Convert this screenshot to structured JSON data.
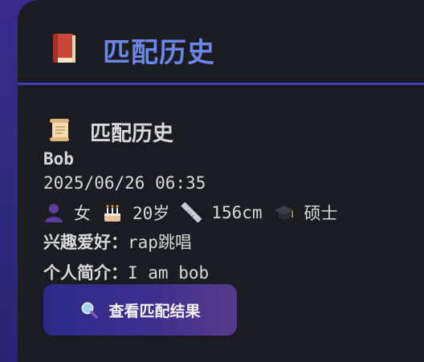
{
  "header": {
    "title": "匹配历史",
    "icon": "book-icon"
  },
  "section": {
    "title": "匹配历史",
    "icon": "scroll-icon"
  },
  "record": {
    "name": "Bob",
    "time": "2025/06/26 06:35",
    "gender": "女",
    "age": "20岁",
    "height": "156cm",
    "education": "硕士",
    "hobby_label": "兴趣爱好：",
    "hobby": "rap跳唱",
    "intro_label": "个人简介：",
    "intro": "I am bob"
  },
  "button": {
    "label": "查看匹配结果",
    "icon": "magnifier-icon"
  },
  "colors": {
    "accent": "#6b86e6",
    "divider": "#3b3fb8",
    "panel": "#1b1c21"
  }
}
